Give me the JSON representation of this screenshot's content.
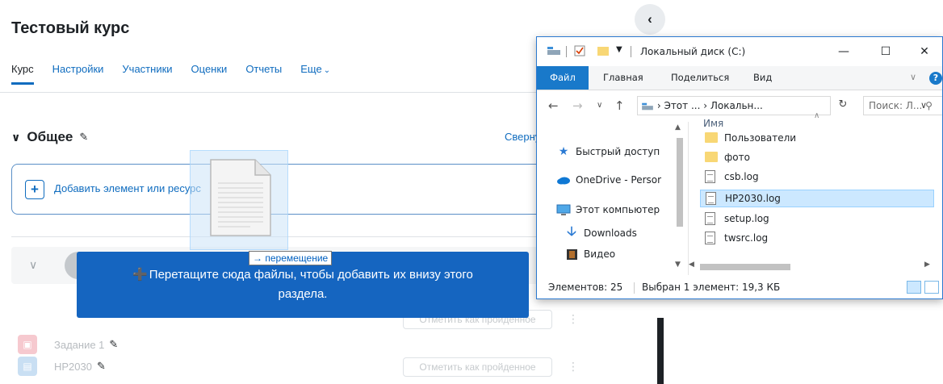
{
  "course": {
    "title": "Тестовый курс",
    "tabs": [
      "Курс",
      "Настройки",
      "Участники",
      "Оценки",
      "Отчеты",
      "Еще"
    ],
    "more_chevron": "⌄",
    "active_tab": "Курс"
  },
  "section": {
    "title": "Общее",
    "collapse_all": "Свернуть",
    "add_element": "Добавить элемент или ресурс"
  },
  "drop_zone": {
    "message": "Перетащите сюда файлы, чтобы добавить их внизу этого раздела."
  },
  "drag": {
    "tooltip": "перемещение"
  },
  "activities": [
    {
      "name": "Задание 1",
      "icon": "assignment-icon",
      "complete_label": "Отметить как пройденное"
    },
    {
      "name": "HP2030",
      "icon": "file-icon",
      "complete_label": "Отметить как пройденное"
    }
  ],
  "explorer": {
    "title": "Локальный диск (C:)",
    "ribbon_tabs": [
      "Файл",
      "Главная",
      "Поделиться",
      "Вид"
    ],
    "address": "› Этот ... › Локальн...",
    "search_placeholder": "Поиск: Л...",
    "nav_items": [
      "Быстрый доступ",
      "OneDrive - Persor",
      "Этот компьютер",
      "Downloads",
      "Видео"
    ],
    "column_header": "Имя",
    "files": [
      {
        "name": "Пользователи",
        "type": "folder"
      },
      {
        "name": "фото",
        "type": "folder"
      },
      {
        "name": "csb.log",
        "type": "file"
      },
      {
        "name": "HP2030.log",
        "type": "file",
        "selected": true
      },
      {
        "name": "setup.log",
        "type": "file"
      },
      {
        "name": "twsrc.log",
        "type": "file"
      }
    ],
    "status_count": "Элементов: 25",
    "status_selected": "Выбран 1 элемент: 19,3 КБ"
  },
  "colors": {
    "moodle_blue": "#0f6cbf",
    "drop_banner": "#1565c0",
    "explorer_accent": "#1979ca",
    "selection": "#cce8ff"
  }
}
